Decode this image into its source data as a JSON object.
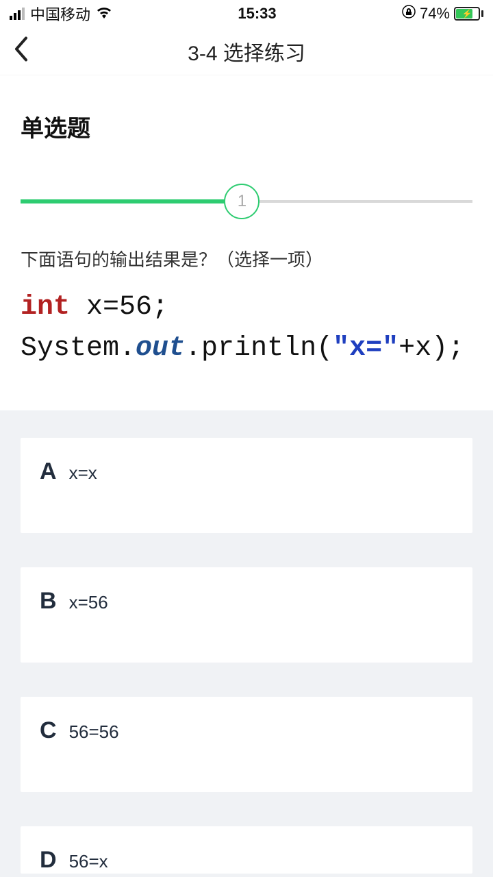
{
  "status": {
    "carrier": "中国移动",
    "time": "15:33",
    "battery_pct": "74%"
  },
  "nav": {
    "title": "3-4 选择练习"
  },
  "question": {
    "type_label": "单选题",
    "progress_current": "1",
    "prompt": "下面语句的输出结果是？（选择一项）",
    "code": {
      "kw_int": "int",
      "line1_rest": " x=56;",
      "line2_pre": "System.",
      "line2_out": "out",
      "line2_mid": ".println(",
      "line2_str": "\"x=\"",
      "line2_post": "+x);"
    }
  },
  "options": [
    {
      "letter": "A",
      "text": "x=x"
    },
    {
      "letter": "B",
      "text": "x=56"
    },
    {
      "letter": "C",
      "text": "56=56"
    },
    {
      "letter": "D",
      "text": "56=x"
    }
  ]
}
